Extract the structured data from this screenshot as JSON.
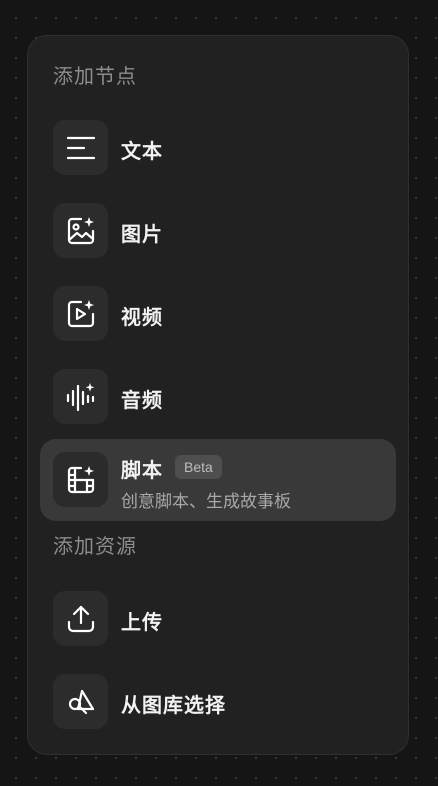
{
  "panel": {
    "nodes_section_title": "添加节点",
    "resources_section_title": "添加资源",
    "nodes": [
      {
        "label": "文本",
        "icon": "text-lines-icon"
      },
      {
        "label": "图片",
        "icon": "image-sparkle-icon"
      },
      {
        "label": "视频",
        "icon": "video-sparkle-icon"
      },
      {
        "label": "音频",
        "icon": "audio-wave-sparkle-icon"
      },
      {
        "label": "脚本",
        "badge": "Beta",
        "description": "创意脚本、生成故事板",
        "icon": "film-sparkle-icon"
      }
    ],
    "resources": [
      {
        "label": "上传",
        "icon": "upload-icon"
      },
      {
        "label": "从图库选择",
        "icon": "library-shapes-icon"
      }
    ]
  },
  "colors": {
    "panel_background": "#212121",
    "active_item_background": "#393939",
    "icon_box_background": "#2c2c2c",
    "section_title": "#8d8d8d",
    "label": "#f2f2f2"
  }
}
